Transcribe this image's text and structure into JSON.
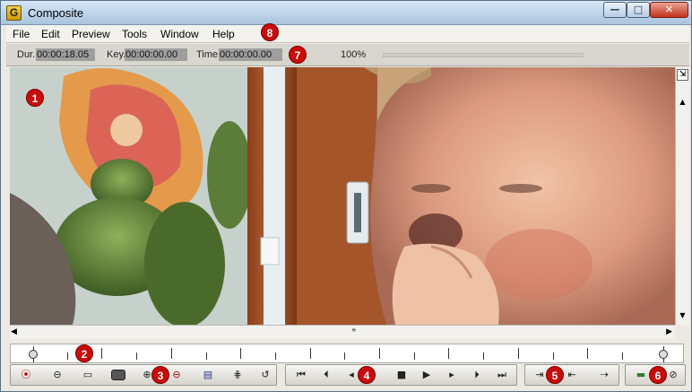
{
  "window": {
    "title": "Composite",
    "app_icon_letter": "G",
    "minimize_glyph": "—",
    "maximize_glyph": "□",
    "close_glyph": "✕"
  },
  "menu": {
    "items": [
      "File",
      "Edit",
      "Preview",
      "Tools",
      "Window",
      "Help"
    ]
  },
  "status": {
    "dur_label": "Dur.",
    "dur_value": "00:00:18.05",
    "key_label": "Key.",
    "key_value": "00:00:00.00",
    "time_label": "Time",
    "time_value": "00:00:00.00",
    "zoom_text": "100%"
  },
  "badges": {
    "preview": "1",
    "timeline": "2",
    "edit_tools": "3",
    "transport": "4",
    "in_out": "5",
    "render": "6",
    "time_fields": "7",
    "menu": "8"
  },
  "scrollbars": {
    "vertical_top_glyph": "⇲",
    "up_glyph": "▲",
    "down_glyph": "▼",
    "left_glyph": "◀",
    "right_glyph": "▶",
    "h_thumb_glyph": "⌖"
  },
  "toolbar": {
    "edit_group": [
      {
        "name": "record-button",
        "glyph": "⦿"
      },
      {
        "name": "keyframe-button",
        "glyph": "⊖"
      },
      {
        "name": "layer-button",
        "glyph": "▭"
      },
      {
        "name": "zoom-in-button",
        "glyph": "⊕"
      },
      {
        "name": "zoom-out-button",
        "glyph": "⊖"
      },
      {
        "name": "color-button",
        "glyph": "▤"
      },
      {
        "name": "grid-button",
        "glyph": "⋕"
      },
      {
        "name": "loop-button",
        "glyph": "↺"
      }
    ],
    "transport_group": [
      {
        "name": "go-to-start-button",
        "glyph": "⏮"
      },
      {
        "name": "previous-key-button",
        "glyph": "⏴"
      },
      {
        "name": "step-back-button",
        "glyph": "◂"
      },
      {
        "name": "stop-button",
        "glyph": "■"
      },
      {
        "name": "play-button",
        "glyph": "▶"
      },
      {
        "name": "step-forward-button",
        "glyph": "▸"
      },
      {
        "name": "next-key-button",
        "glyph": "⏵"
      },
      {
        "name": "go-to-end-button",
        "glyph": "⏭"
      }
    ],
    "inout_group": [
      {
        "name": "mark-in-button",
        "glyph": "⇥"
      },
      {
        "name": "mark-out-button",
        "glyph": "⇤"
      },
      {
        "name": "go-to-out-button",
        "glyph": "⇢"
      }
    ],
    "render_group": [
      {
        "name": "render-button",
        "glyph": "▬"
      },
      {
        "name": "disable-button",
        "glyph": "⊘"
      }
    ]
  },
  "colors": {
    "badge": "#c90b0b",
    "time_field_bg": "#9e9e9e"
  }
}
